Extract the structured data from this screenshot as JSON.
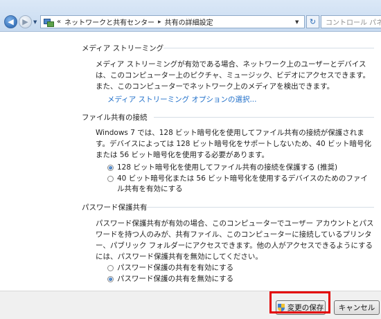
{
  "address_bar": {
    "crumb_prefix": "«",
    "crumbs": [
      "ネットワークと共有センター",
      "共有の詳細設定"
    ],
    "search_placeholder": "コントロール パネル"
  },
  "sections": {
    "media": {
      "title": "メディア ストリーミング",
      "description": "メディア ストリーミングが有効である場合、ネットワーク上のユーザーとデバイスは、このコンピューター上のピクチャ、ミュージック、ビデオにアクセスできます。また、このコンピューターでネットワーク上のメディアを検出できます。",
      "link": "メディア ストリーミング オプションの選択..."
    },
    "file_sharing": {
      "title": "ファイル共有の接続",
      "description": "Windows 7 では、128 ビット暗号化を使用してファイル共有の接続が保護されます。デバイスによっては 128 ビット暗号化をサポートしないため、40 ビット暗号化または 56 ビット暗号化を使用する必要があります。",
      "options": [
        {
          "label": "128 ビット暗号化を使用してファイル共有の接続を保護する (推奨)",
          "checked": true
        },
        {
          "label": "40 ビット暗号化または 56 ビット暗号化を使用するデバイスのためのファイル共有を有効にする",
          "checked": false
        }
      ]
    },
    "password": {
      "title": "パスワード保護共有",
      "description": "パスワード保護共有が有効の場合、このコンピューターでユーザー アカウントとパスワードを持つ人のみが、共有ファイル、このコンピューターに接続しているプリンター、パブリック フォルダーにアクセスできます。他の人がアクセスできるようにするには、パスワード保護共有を無効にしてください。",
      "options": [
        {
          "label": "パスワード保護の共有を有効にする",
          "checked": false
        },
        {
          "label": "パスワード保護の共有を無効にする",
          "checked": true
        }
      ]
    }
  },
  "buttons": {
    "save": "変更の保存",
    "cancel": "キャンセル"
  },
  "colors": {
    "link": "#1e6ec9",
    "highlight": "#e30000"
  }
}
